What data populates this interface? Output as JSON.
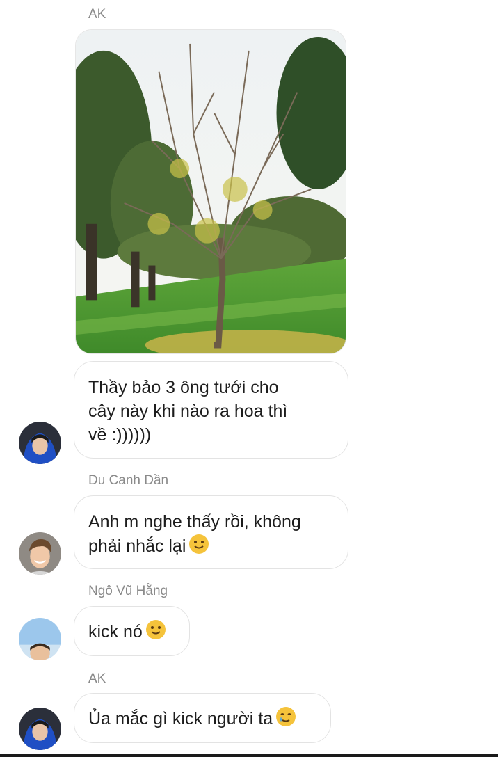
{
  "colors": {
    "bubble_border": "#e3e3e3",
    "sender_name": "#8a8a8a",
    "text": "#1d1d1d",
    "emoji": "#f5c33b"
  },
  "messages": [
    {
      "sender": "AK",
      "type": "image",
      "image_alt": "tree-in-park"
    },
    {
      "sender": "",
      "type": "text",
      "text": "Thầy bảo 3 ông tưới cho\ncây này khi nào ra hoa thì\nvề :))))))",
      "avatar": "blue-hoodie-avatar"
    },
    {
      "sender": "Du Canh Dần",
      "type": "text",
      "text": "Anh m nghe thấy rồi, không\nphải nhắc lại",
      "emoji": "slightly-smiling-face-icon",
      "avatar": "smiling-man-avatar"
    },
    {
      "sender": "Ngô Vũ Hằng",
      "type": "text",
      "text": "kick nó",
      "emoji": "slightly-smiling-face-icon",
      "avatar": "sky-portrait-avatar"
    },
    {
      "sender": "AK",
      "type": "text",
      "text": "Ủa mắc gì kick người ta",
      "emoji": "smiling-face-with-tear-icon",
      "avatar": "blue-hoodie-avatar"
    }
  ]
}
